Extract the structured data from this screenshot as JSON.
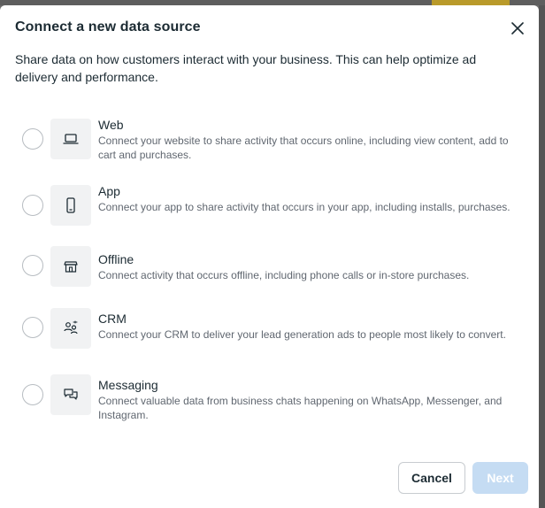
{
  "dialog": {
    "title": "Connect a new data source",
    "description": "Share data on how customers interact with your business. This can help optimize ad delivery and performance."
  },
  "options": [
    {
      "title": "Web",
      "description": "Connect your website to share activity that occurs online, including view content, add to cart and purchases.",
      "icon": "laptop-icon"
    },
    {
      "title": "App",
      "description": "Connect your app to share activity that occurs in your app, including installs, purchases.",
      "icon": "phone-icon"
    },
    {
      "title": "Offline",
      "description": "Connect activity that occurs offline, including phone calls or in-store purchases.",
      "icon": "store-icon"
    },
    {
      "title": "CRM",
      "description": "Connect your CRM to deliver your lead generation ads to people most likely to convert.",
      "icon": "people-icon"
    },
    {
      "title": "Messaging",
      "description": "Connect valuable data from business chats happening on WhatsApp, Messenger, and Instagram.",
      "icon": "chat-icon"
    }
  ],
  "buttons": {
    "cancel": "Cancel",
    "next": "Next"
  },
  "colors": {
    "next_disabled_bg": "#c5dcf3",
    "text_primary": "#1c2b33",
    "text_secondary": "#606770"
  }
}
